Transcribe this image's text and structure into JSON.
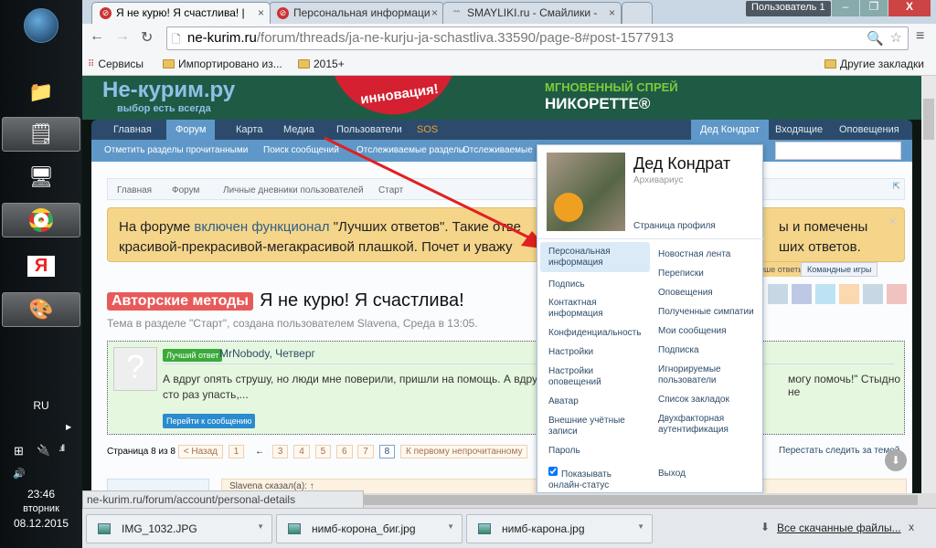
{
  "taskbar": {
    "language": "RU",
    "time": "23:46",
    "weekday": "вторник",
    "date": "08.12.2015"
  },
  "tabs": [
    {
      "title": "Я не курю! Я счастлива! |",
      "active": true
    },
    {
      "title": "Персональная информаци",
      "active": false
    },
    {
      "title": "SMAYLIKI.ru - Смайлики -",
      "active": false
    }
  ],
  "window": {
    "user_label": "Пользователь 1"
  },
  "address": {
    "domain": "ne-kurim.ru",
    "path": "/forum/threads/ja-ne-kurju-ja-schastliva.33590/page-8#post-1577913"
  },
  "bookmarks": {
    "apps": "Сервисы",
    "items": [
      "Импортировано из...",
      "2015+"
    ],
    "other": "Другие закладки"
  },
  "site": {
    "logo": "Не-курим.ру",
    "slogan": "выбор есть всегда",
    "ad_badge": "инновация!",
    "ad_line1": "МГНОВЕННЫЙ СПРЕЙ",
    "ad_line2": "НИКОРЕТТЕ®"
  },
  "nav": {
    "items": [
      "Главная",
      "Форум",
      "Карта",
      "Медиа",
      "Пользователи",
      "SOS"
    ],
    "user": "Дед Кондрат",
    "inbox": "Входящие",
    "alerts": "Оповещения"
  },
  "subnav": [
    "Отметить разделы прочитанными",
    "Поиск сообщений",
    "Отслеживаемые разделы",
    "Отслеживаемые"
  ],
  "breadcrumb": [
    "Главная",
    "Форум",
    "Личные дневники пользователей",
    "Старт"
  ],
  "notice": {
    "p1": "На форуме ",
    "link": "включен функционал",
    "p2": " \"Лучших ответов\". Такие отве",
    "tail1": "ы и помечены",
    "line2a": "красивой-прекрасивой-мегакрасивой плашкой. Почет и уважу",
    "tail2": "ших ответов.",
    "tab1": "ише ответы",
    "tab2": "Командные игры"
  },
  "thread": {
    "prefix": "Авторские методы",
    "title": "Я не курю! Я счастлива!",
    "meta": "Тема в разделе \"Старт\", создана пользователем Slavena, Среда в 13:05."
  },
  "best_answer": {
    "badge": "Лучший ответ",
    "author": "MrNobody, Четверг",
    "text1": "А вдруг опять струшу, но люди мне поверили, пришли на помощь. А вдру",
    "text1_tail": "могу помочь!\" Стыдно не",
    "text2": "сто раз упасть,...",
    "button": "Перейти к сообщению"
  },
  "pagination": {
    "label": "Страница 8 из 8",
    "prev": "< Назад",
    "pages": [
      "1",
      "←",
      "3",
      "4",
      "5",
      "6",
      "7",
      "8"
    ],
    "current": "8",
    "first_unread": "К первому непрочитанному",
    "unwatch": "Перестать следить за темой"
  },
  "quote_stub": "Slavena сказал(а): ↑",
  "dropdown": {
    "name": "Дед Кондрат",
    "title": "Архивариус",
    "profile_link": "Страница профиля",
    "left": [
      "Персональная информация",
      "Подпись",
      "Контактная информация",
      "Конфиденциальность",
      "Настройки",
      "Настройки оповещений",
      "Аватар",
      "Внешние учётные записи",
      "Пароль"
    ],
    "right": [
      "Новостная лента",
      "Переписки",
      "Оповещения",
      "Полученные симпатии",
      "Мои сообщения",
      "Подписка",
      "Игнорируемые пользователи",
      "Список закладок",
      "Двухфакторная аутентификация"
    ],
    "online_status": "Показывать онлайн-статус",
    "online_checked": true,
    "logout": "Выход"
  },
  "status_url": "ne-kurim.ru/forum/account/personal-details",
  "downloads": {
    "files": [
      "IMG_1032.JPG",
      "нимб-корона_биг.jpg",
      "нимб-карона.jpg"
    ],
    "all": "Все скачанные файлы...",
    "close": "x"
  },
  "colors": {
    "header": "#1f5a45",
    "nav": "#2c4b6c",
    "subnav": "#5f98c8",
    "notice": "#f5d58a",
    "prefix": "#e85a5a",
    "arrow": "#e02020"
  }
}
